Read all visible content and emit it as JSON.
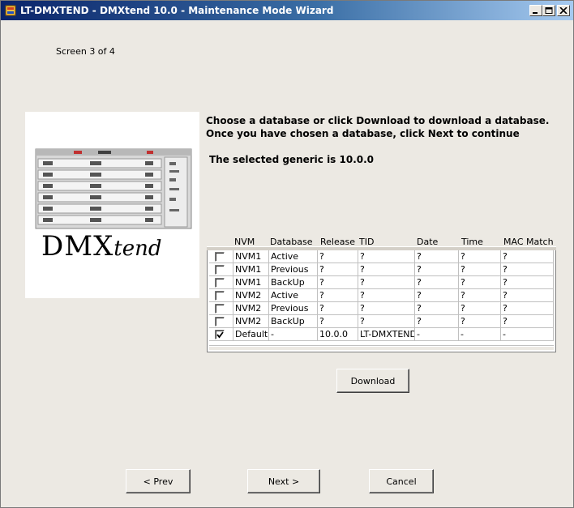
{
  "window": {
    "title": "LT-DMXTEND - DMXtend 10.0 - Maintenance Mode Wizard",
    "icon": "app-icon",
    "controls": [
      "minimize-icon",
      "maximize-icon",
      "close-icon"
    ]
  },
  "wizard": {
    "screen": "Screen 3 of 4",
    "instruction_line1": "Choose a database or click Download to download a database.",
    "instruction_line2": "Once you have chosen a database, click Next to continue",
    "selected_generic": "The selected generic is 10.0.0"
  },
  "logo": {
    "text_big": "DMX",
    "text_small": "tend"
  },
  "table": {
    "columns": [
      "NVM",
      "Database",
      "Release",
      "TID",
      "Date",
      "Time",
      "MAC Match"
    ],
    "rows": [
      {
        "checked": false,
        "nvm": "NVM1",
        "database": "Active",
        "release": "?",
        "tid": "?",
        "date": "?",
        "time": "?",
        "mac": "?"
      },
      {
        "checked": false,
        "nvm": "NVM1",
        "database": "Previous",
        "release": "?",
        "tid": "?",
        "date": "?",
        "time": "?",
        "mac": "?"
      },
      {
        "checked": false,
        "nvm": "NVM1",
        "database": "BackUp",
        "release": "?",
        "tid": "?",
        "date": "?",
        "time": "?",
        "mac": "?"
      },
      {
        "checked": false,
        "nvm": "NVM2",
        "database": "Active",
        "release": "?",
        "tid": "?",
        "date": "?",
        "time": "?",
        "mac": "?"
      },
      {
        "checked": false,
        "nvm": "NVM2",
        "database": "Previous",
        "release": "?",
        "tid": "?",
        "date": "?",
        "time": "?",
        "mac": "?"
      },
      {
        "checked": false,
        "nvm": "NVM2",
        "database": "BackUp",
        "release": "?",
        "tid": "?",
        "date": "?",
        "time": "?",
        "mac": "?"
      },
      {
        "checked": true,
        "nvm": "Default",
        "database": "-",
        "release": "10.0.0",
        "tid": "LT-DMXTEND",
        "date": "-",
        "time": "-",
        "mac": "-"
      }
    ]
  },
  "buttons": {
    "download": "Download",
    "prev": "< Prev",
    "next": "Next >",
    "cancel": "Cancel"
  }
}
